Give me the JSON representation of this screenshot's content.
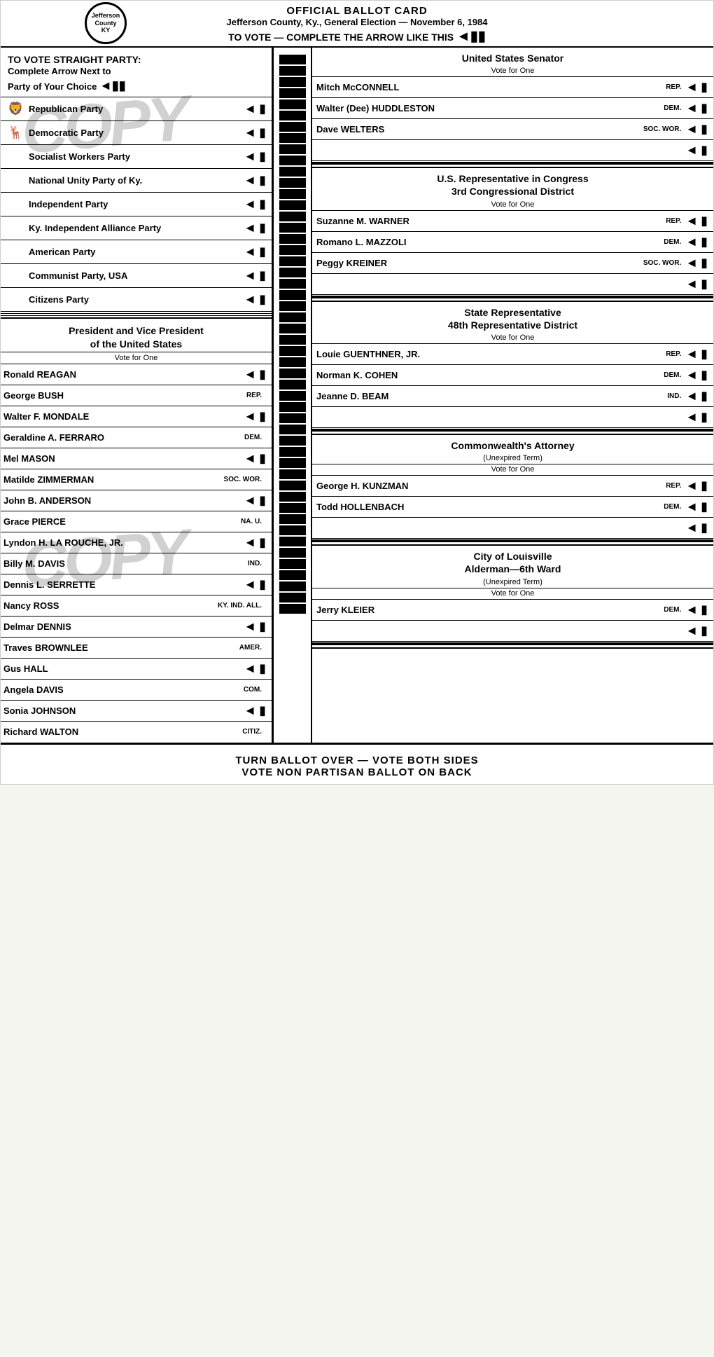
{
  "header": {
    "official_title": "OFFICIAL BALLOT CARD",
    "election_info": "Jefferson County, Ky., General Election — November 6, 1984",
    "vote_instruction": "TO VOTE — COMPLETE THE ARROW LIKE THIS"
  },
  "straight_party": {
    "header_line1": "TO VOTE STRAIGHT PARTY:",
    "header_line2": "Complete Arrow Next to",
    "header_line3": "Party of Your Choice",
    "parties": [
      {
        "name": "Republican Party",
        "has_icon": true,
        "has_arrow": true
      },
      {
        "name": "Democratic Party",
        "has_icon": true,
        "has_arrow": true
      },
      {
        "name": "Socialist Workers Party",
        "has_icon": false,
        "has_arrow": true
      },
      {
        "name": "National Unity Party of Ky.",
        "has_icon": false,
        "has_arrow": true
      },
      {
        "name": "Independent Party",
        "has_icon": false,
        "has_arrow": true
      },
      {
        "name": "Ky. Independent Alliance Party",
        "has_icon": false,
        "has_arrow": true
      },
      {
        "name": "American Party",
        "has_icon": false,
        "has_arrow": true
      },
      {
        "name": "Communist Party, USA",
        "has_icon": false,
        "has_arrow": true
      },
      {
        "name": "Citizens Party",
        "has_icon": false,
        "has_arrow": true
      }
    ]
  },
  "president_section": {
    "title_line1": "President and Vice President",
    "title_line2": "of the United States",
    "vote_for": "Vote for One",
    "candidates": [
      {
        "first": "Ronald",
        "last": "REAGAN",
        "party": "",
        "has_arrow": true,
        "running_mate": "George BUSH",
        "running_mate_party": "REP."
      },
      {
        "first": "Walter F.",
        "last": "MONDALE",
        "party": "",
        "has_arrow": true,
        "running_mate": "Geraldine A. FERRARO",
        "running_mate_party": "DEM."
      },
      {
        "first": "Mel",
        "last": "MASON",
        "party": "",
        "has_arrow": true,
        "running_mate": "Matilde ZIMMERMAN",
        "running_mate_party": "SOC. WOR."
      },
      {
        "first": "John B.",
        "last": "ANDERSON",
        "party": "",
        "has_arrow": true,
        "running_mate": "Grace PIERCE",
        "running_mate_party": "NA. U."
      },
      {
        "first": "Lyndon H.",
        "last": "LA ROUCHE, JR.",
        "party": "",
        "has_arrow": true,
        "running_mate": "Billy M. DAVIS",
        "running_mate_party": "IND."
      },
      {
        "first": "Dennis L.",
        "last": "SERRETTE",
        "party": "",
        "has_arrow": true,
        "running_mate": "Nancy ROSS",
        "running_mate_party": "KY. IND. ALL."
      },
      {
        "first": "Delmar",
        "last": "DENNIS",
        "party": "",
        "has_arrow": true,
        "running_mate": "Traves BROWNLEE",
        "running_mate_party": "AMER."
      },
      {
        "first": "Gus",
        "last": "HALL",
        "party": "",
        "has_arrow": true,
        "running_mate": "Angela DAVIS",
        "running_mate_party": "COM."
      },
      {
        "first": "Sonia",
        "last": "JOHNSON",
        "party": "",
        "has_arrow": true,
        "running_mate": "Richard WALTON",
        "running_mate_party": "CITIZ."
      }
    ]
  },
  "us_senator": {
    "title": "United States Senator",
    "vote_for": "Vote for One",
    "candidates": [
      {
        "name": "Mitch McCONNELL",
        "party": "REP.",
        "has_arrow": true
      },
      {
        "name": "Walter (Dee) HUDDLESTON",
        "party": "DEM.",
        "has_arrow": true
      },
      {
        "name": "Dave WELTERS",
        "party": "SOC. WOR.",
        "has_arrow": true
      },
      {
        "name": "",
        "party": "",
        "has_arrow": true
      }
    ]
  },
  "us_rep": {
    "title_line1": "U.S. Representative in Congress",
    "title_line2": "3rd Congressional District",
    "vote_for": "Vote for One",
    "candidates": [
      {
        "name": "Suzanne M. WARNER",
        "party": "REP.",
        "has_arrow": true
      },
      {
        "name": "Romano L. MAZZOLI",
        "party": "DEM.",
        "has_arrow": true
      },
      {
        "name": "Peggy KREINER",
        "party": "SOC. WOR.",
        "has_arrow": true
      },
      {
        "name": "",
        "party": "",
        "has_arrow": true
      }
    ]
  },
  "state_rep": {
    "title_line1": "State Representative",
    "title_line2": "48th Representative District",
    "vote_for": "Vote for One",
    "candidates": [
      {
        "name": "Louie GUENTHNER, JR.",
        "party": "REP.",
        "has_arrow": true
      },
      {
        "name": "Norman K. COHEN",
        "party": "DEM.",
        "has_arrow": true
      },
      {
        "name": "Jeanne D. BEAM",
        "party": "IND.",
        "has_arrow": true
      },
      {
        "name": "",
        "party": "",
        "has_arrow": true
      }
    ]
  },
  "commonwealth_attorney": {
    "title": "Commonwealth's Attorney",
    "subtitle": "(Unexpired Term)",
    "vote_for": "Vote for One",
    "candidates": [
      {
        "name": "George H. KUNZMAN",
        "party": "REP.",
        "has_arrow": true
      },
      {
        "name": "Todd HOLLENBACH",
        "party": "DEM.",
        "has_arrow": true
      },
      {
        "name": "",
        "party": "",
        "has_arrow": true
      }
    ]
  },
  "city_alderman": {
    "title_line1": "City of Louisville",
    "title_line2": "Alderman—6th Ward",
    "subtitle": "(Unexpired Term)",
    "vote_for": "Vote for One",
    "candidates": [
      {
        "name": "Jerry KLEIER",
        "party": "DEM.",
        "has_arrow": true
      },
      {
        "name": "",
        "party": "",
        "has_arrow": true
      }
    ]
  },
  "footer": {
    "line1": "TURN BALLOT OVER — VOTE BOTH SIDES",
    "line2": "VOTE NON PARTISAN BALLOT ON BACK"
  },
  "watermark": "COPY"
}
